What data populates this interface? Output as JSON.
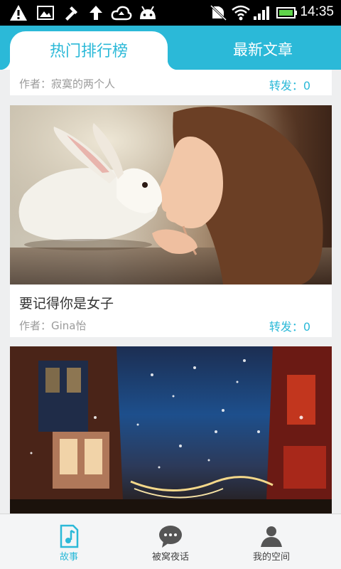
{
  "status_bar": {
    "time": "14:35",
    "left_icons": [
      "warning-icon",
      "image-icon",
      "tools-icon",
      "upload-icon",
      "cloud-icon",
      "android-icon"
    ],
    "right_icons": [
      "mute-icon",
      "wifi-icon",
      "signal-icon",
      "battery-icon"
    ]
  },
  "tabs": [
    {
      "label": "热门排行榜",
      "active": true
    },
    {
      "label": "最新文章",
      "active": false
    }
  ],
  "articles": [
    {
      "title": "",
      "author": "作者：寂寞的两个人",
      "share": "转发：0"
    },
    {
      "title": "要记得你是女子",
      "author": "作者：Gina怡",
      "share": "转发：0"
    },
    {
      "title": "",
      "author": "",
      "share": ""
    }
  ],
  "bottom_nav": [
    {
      "label": "故事",
      "icon": "document-music-icon",
      "active": true
    },
    {
      "label": "被窝夜话",
      "icon": "chat-bubble-icon",
      "active": false
    },
    {
      "label": "我的空间",
      "icon": "person-icon",
      "active": false
    }
  ],
  "colors": {
    "accent": "#2bb9d8",
    "background": "#eeeff0",
    "status_bar": "#000000"
  }
}
